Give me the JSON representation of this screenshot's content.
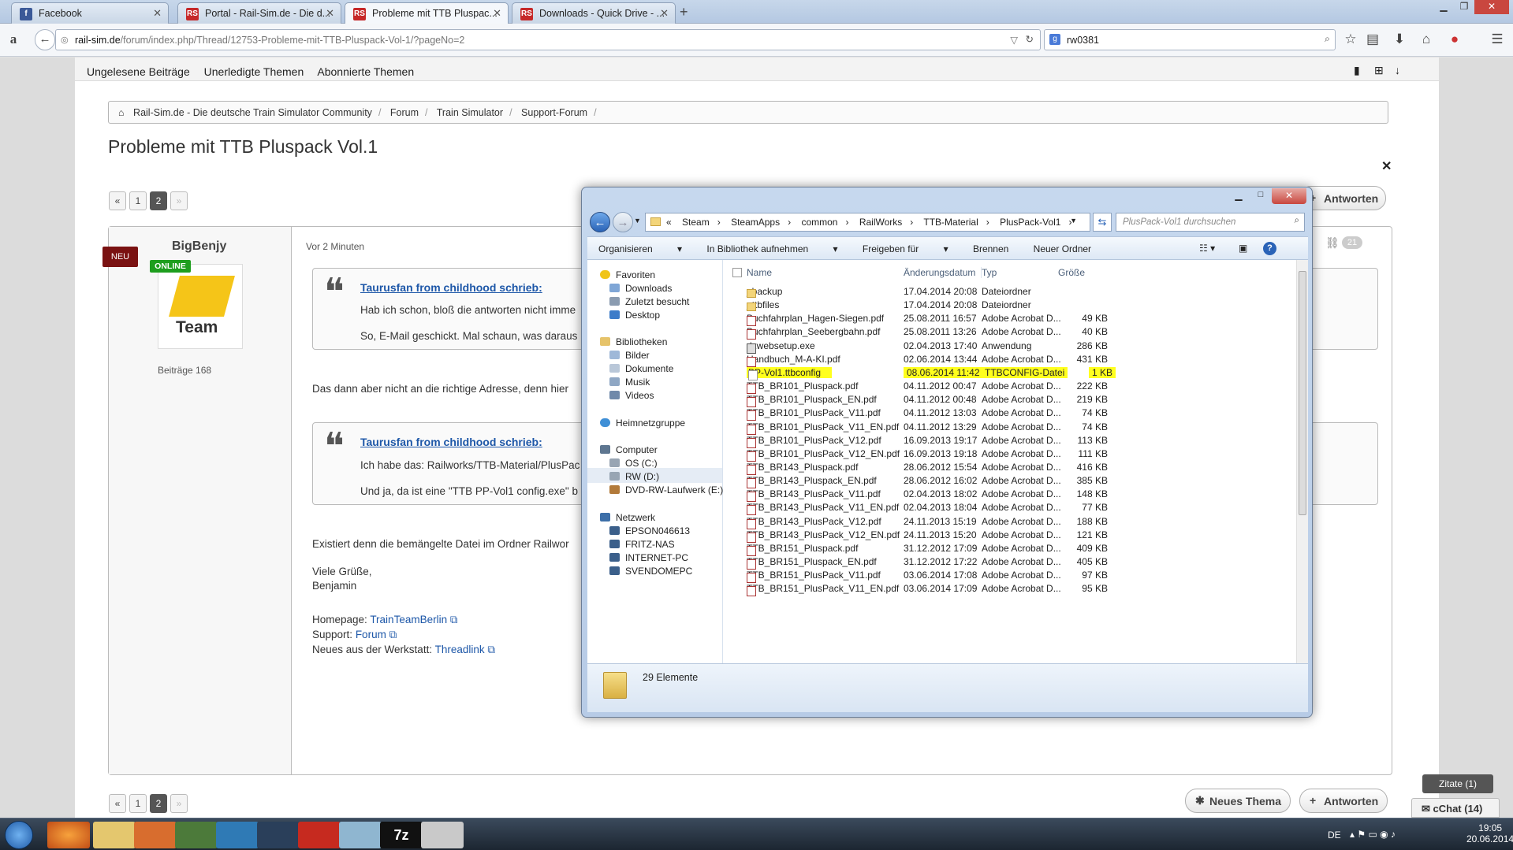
{
  "browser": {
    "tabs": [
      {
        "title": "Facebook",
        "icon": "facebook-icon"
      },
      {
        "title": "Portal - Rail-Sim.de - Die d...",
        "icon": "railsim-icon"
      },
      {
        "title": "Probleme mit TTB Pluspac...",
        "icon": "railsim-icon"
      },
      {
        "title": "Downloads - Quick Drive - ...",
        "icon": "railsim-icon"
      }
    ],
    "url_host": "rail-sim.de",
    "url_path": "/forum/index.php/Thread/12753-Probleme-mit-TTB-Pluspack-Vol-1/?pageNo=2",
    "search_value": "rw0381"
  },
  "subnav": [
    "Ungelesene Beiträge",
    "Unerledigte Themen",
    "Abonnierte Themen"
  ],
  "breadcrumb": [
    "Rail-Sim.de - Die deutsche Train Simulator Community",
    "Forum",
    "Train Simulator",
    "Support-Forum"
  ],
  "thread_title": "Probleme mit TTB Pluspack Vol.1",
  "pagination": {
    "pages": [
      "1",
      "2"
    ],
    "current": "2",
    "first": "«",
    "next": "»"
  },
  "buttons": {
    "reply": "Antworten",
    "new_thread": "Neues Thema",
    "quotes": "Zitate (1)",
    "chat": "cChat (14)"
  },
  "post": {
    "author": "BigBenjy",
    "new_badge": "NEU",
    "online_badge": "ONLINE",
    "avatar_text": "Team",
    "post_count": "Beiträge 168",
    "time": "Vor 2 Minuten",
    "likes": "21",
    "quote1": {
      "author": "Taurusfan from childhood schrieb:",
      "line1": "Hab ich schon, bloß die antworten nicht imme",
      "line2": "So, E-Mail geschickt. Mal schaun, was daraus"
    },
    "text1": "Das dann aber nicht an die richtige Adresse, denn hier",
    "quote2": {
      "author": "Taurusfan from childhood schrieb:",
      "line1": "Ich habe das: Railworks/TTB-Material/PlusPac",
      "line2": "Und ja, da ist eine \"TTB PP-Vol1 config.exe\" b"
    },
    "text2": "Existiert denn die bemängelte Datei im Ordner Railwor",
    "greeting": "Viele Grüße,",
    "signature_name": "Benjamin",
    "homepage_label": "Homepage:",
    "homepage_link": "TrainTeamBerlin",
    "support_label": "Support:",
    "support_link": "Forum",
    "werkstatt_label": "Neues aus der Werkstatt:",
    "werkstatt_link": "Threadlink"
  },
  "explorer": {
    "path": [
      "«",
      "Steam",
      "SteamApps",
      "common",
      "RailWorks",
      "TTB-Material",
      "PlusPack-Vol1"
    ],
    "search_placeholder": "PlusPack-Vol1 durchsuchen",
    "toolbar": [
      "Organisieren",
      "In Bibliothek aufnehmen",
      "Freigeben für",
      "Brennen",
      "Neuer Ordner"
    ],
    "nav": {
      "favoriten": "Favoriten",
      "fav_items": [
        "Downloads",
        "Zuletzt besucht",
        "Desktop"
      ],
      "bibliotheken": "Bibliotheken",
      "lib_items": [
        "Bilder",
        "Dokumente",
        "Musik",
        "Videos"
      ],
      "heimnetz": "Heimnetzgruppe",
      "computer": "Computer",
      "comp_items": [
        "OS (C:)",
        "RW (D:)",
        "DVD-RW-Laufwerk (E:)"
      ],
      "netzwerk": "Netzwerk",
      "net_items": [
        "EPSON046613",
        "FRITZ-NAS",
        "INTERNET-PC",
        "SVENDOMEPC"
      ]
    },
    "columns": {
      "name": "Name",
      "date": "Änderungsdatum",
      "type": "Typ",
      "size": "Größe"
    },
    "files": [
      {
        "name": "_backup",
        "date": "17.04.2014 20:08",
        "type": "Dateiordner",
        "size": "",
        "kind": "folder"
      },
      {
        "name": "_ttbfiles",
        "date": "17.04.2014 20:08",
        "type": "Dateiordner",
        "size": "",
        "kind": "folder"
      },
      {
        "name": "Buchfahrplan_Hagen-Siegen.pdf",
        "date": "25.08.2011 16:57",
        "type": "Adobe Acrobat D...",
        "size": "49 KB",
        "kind": "pdf"
      },
      {
        "name": "Buchfahrplan_Seebergbahn.pdf",
        "date": "25.08.2011 13:26",
        "type": "Adobe Acrobat D...",
        "size": "40 KB",
        "kind": "pdf"
      },
      {
        "name": "dxwebsetup.exe",
        "date": "02.04.2013 17:40",
        "type": "Anwendung",
        "size": "286 KB",
        "kind": "exe"
      },
      {
        "name": "Handbuch_M-A-KI.pdf",
        "date": "02.06.2014 13:44",
        "type": "Adobe Acrobat D...",
        "size": "431 KB",
        "kind": "pdf"
      },
      {
        "name": "PP-Vol1.ttbconfig",
        "date": "08.06.2014 11:42",
        "type": "TTBCONFIG-Datei",
        "size": "1 KB",
        "kind": "cfg",
        "highlight": true
      },
      {
        "name": "TTB_BR101_Pluspack.pdf",
        "date": "04.11.2012 00:47",
        "type": "Adobe Acrobat D...",
        "size": "222 KB",
        "kind": "pdf"
      },
      {
        "name": "TTB_BR101_Pluspack_EN.pdf",
        "date": "04.11.2012 00:48",
        "type": "Adobe Acrobat D...",
        "size": "219 KB",
        "kind": "pdf"
      },
      {
        "name": "TTB_BR101_PlusPack_V11.pdf",
        "date": "04.11.2012 13:03",
        "type": "Adobe Acrobat D...",
        "size": "74 KB",
        "kind": "pdf"
      },
      {
        "name": "TTB_BR101_PlusPack_V11_EN.pdf",
        "date": "04.11.2012 13:29",
        "type": "Adobe Acrobat D...",
        "size": "74 KB",
        "kind": "pdf"
      },
      {
        "name": "TTB_BR101_PlusPack_V12.pdf",
        "date": "16.09.2013 19:17",
        "type": "Adobe Acrobat D...",
        "size": "113 KB",
        "kind": "pdf"
      },
      {
        "name": "TTB_BR101_PlusPack_V12_EN.pdf",
        "date": "16.09.2013 19:18",
        "type": "Adobe Acrobat D...",
        "size": "111 KB",
        "kind": "pdf"
      },
      {
        "name": "TTB_BR143_Pluspack.pdf",
        "date": "28.06.2012 15:54",
        "type": "Adobe Acrobat D...",
        "size": "416 KB",
        "kind": "pdf"
      },
      {
        "name": "TTB_BR143_Pluspack_EN.pdf",
        "date": "28.06.2012 16:02",
        "type": "Adobe Acrobat D...",
        "size": "385 KB",
        "kind": "pdf"
      },
      {
        "name": "TTB_BR143_PlusPack_V11.pdf",
        "date": "02.04.2013 18:02",
        "type": "Adobe Acrobat D...",
        "size": "148 KB",
        "kind": "pdf"
      },
      {
        "name": "TTB_BR143_PlusPack_V11_EN.pdf",
        "date": "02.04.2013 18:04",
        "type": "Adobe Acrobat D...",
        "size": "77 KB",
        "kind": "pdf"
      },
      {
        "name": "TTB_BR143_PlusPack_V12.pdf",
        "date": "24.11.2013 15:19",
        "type": "Adobe Acrobat D...",
        "size": "188 KB",
        "kind": "pdf"
      },
      {
        "name": "TTB_BR143_PlusPack_V12_EN.pdf",
        "date": "24.11.2013 15:20",
        "type": "Adobe Acrobat D...",
        "size": "121 KB",
        "kind": "pdf"
      },
      {
        "name": "TTB_BR151_Pluspack.pdf",
        "date": "31.12.2012 17:09",
        "type": "Adobe Acrobat D...",
        "size": "409 KB",
        "kind": "pdf"
      },
      {
        "name": "TTB_BR151_Pluspack_EN.pdf",
        "date": "31.12.2012 17:22",
        "type": "Adobe Acrobat D...",
        "size": "405 KB",
        "kind": "pdf"
      },
      {
        "name": "TTB_BR151_PlusPack_V11.pdf",
        "date": "03.06.2014 17:08",
        "type": "Adobe Acrobat D...",
        "size": "97 KB",
        "kind": "pdf"
      },
      {
        "name": "TTB_BR151_PlusPack_V11_EN.pdf",
        "date": "03.06.2014 17:09",
        "type": "Adobe Acrobat D...",
        "size": "95 KB",
        "kind": "pdf"
      }
    ],
    "status": "29 Elemente"
  },
  "taskbar": {
    "lang": "DE",
    "time": "19:05",
    "date": "20.06.2014"
  },
  "colors": {
    "highlight": "#ffff1e",
    "link": "#1d57a8",
    "online": "#1e9e1e",
    "new_badge": "#7a1212"
  }
}
